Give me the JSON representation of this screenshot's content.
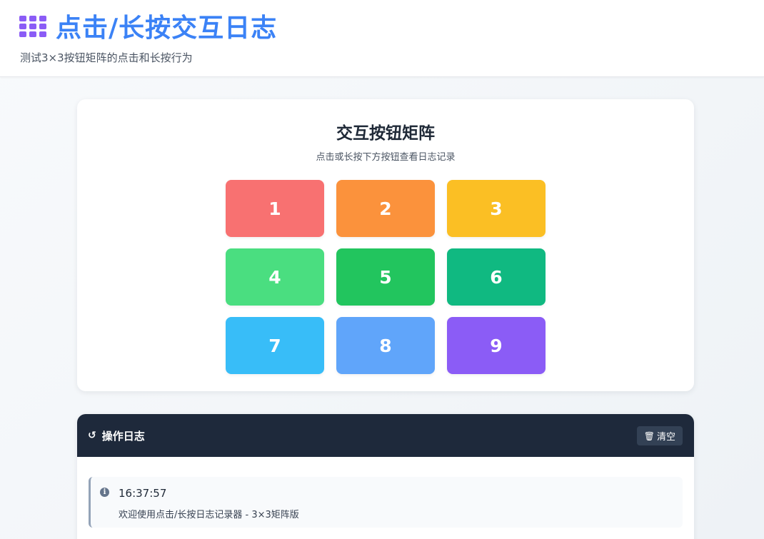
{
  "header": {
    "icon": "grid-icon",
    "title": "点击/长按交互日志",
    "subtitle": "测试3×3按钮矩阵的点击和长按行为"
  },
  "matrix": {
    "title": "交互按钮矩阵",
    "hint": "点击或长按下方按钮查看日志记录",
    "buttons": [
      {
        "label": "1",
        "color": "#f87171"
      },
      {
        "label": "2",
        "color": "#fb923c"
      },
      {
        "label": "3",
        "color": "#fbbf24"
      },
      {
        "label": "4",
        "color": "#4ade80"
      },
      {
        "label": "5",
        "color": "#22c55e"
      },
      {
        "label": "6",
        "color": "#10b981"
      },
      {
        "label": "7",
        "color": "#38bdf8"
      },
      {
        "label": "8",
        "color": "#60a5fa"
      },
      {
        "label": "9",
        "color": "#8b5cf6"
      }
    ]
  },
  "log": {
    "icon": "history-icon",
    "title": "操作日志",
    "clear_label": "清空",
    "entries": [
      {
        "icon": "info-icon",
        "time": "16:37:57",
        "message": "欢迎使用点击/长按日志记录器 - 3×3矩阵版"
      }
    ]
  },
  "colors": {
    "accent": "#3b82f6",
    "log_header_bg": "#1e293b"
  }
}
